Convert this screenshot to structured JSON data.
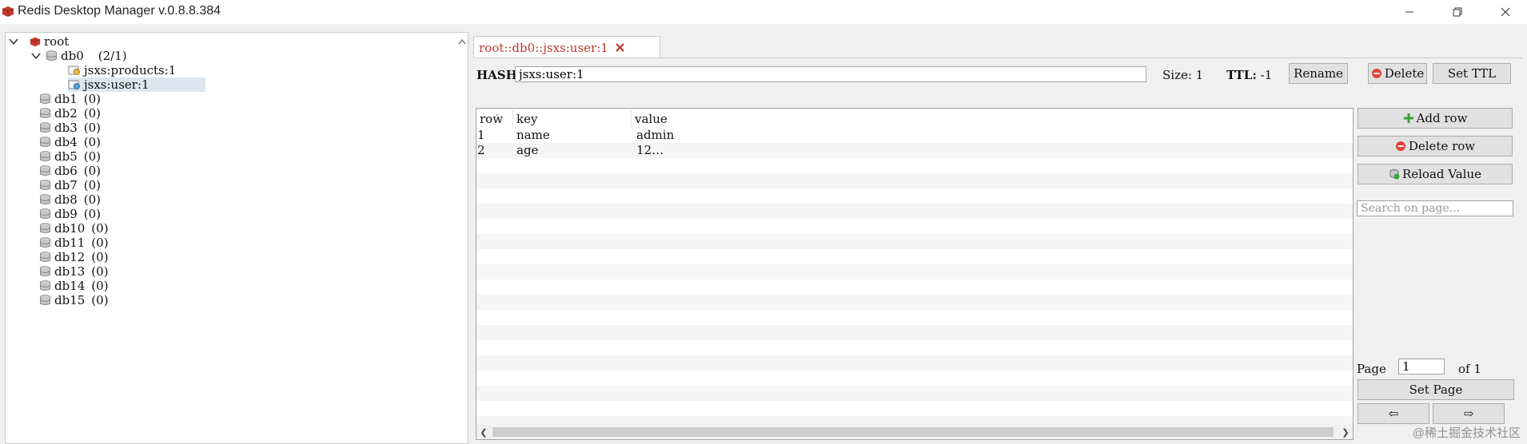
{
  "window": {
    "title": "Redis Desktop Manager v.0.8.8.384",
    "minimize_icon": "minimize-icon",
    "restore_icon": "restore-icon",
    "close_icon": "close-icon"
  },
  "tree": {
    "root_label": "root",
    "db0_label": "db0",
    "db0_count": "(2/1)",
    "keys": [
      "jsxs:products:1",
      "jsxs:user:1"
    ],
    "dbs": [
      {
        "name": "db1",
        "count": "(0)"
      },
      {
        "name": "db2",
        "count": "(0)"
      },
      {
        "name": "db3",
        "count": "(0)"
      },
      {
        "name": "db4",
        "count": "(0)"
      },
      {
        "name": "db5",
        "count": "(0)"
      },
      {
        "name": "db6",
        "count": "(0)"
      },
      {
        "name": "db7",
        "count": "(0)"
      },
      {
        "name": "db8",
        "count": "(0)"
      },
      {
        "name": "db9",
        "count": "(0)"
      },
      {
        "name": "db10",
        "count": "(0)"
      },
      {
        "name": "db11",
        "count": "(0)"
      },
      {
        "name": "db12",
        "count": "(0)"
      },
      {
        "name": "db13",
        "count": "(0)"
      },
      {
        "name": "db14",
        "count": "(0)"
      },
      {
        "name": "db15",
        "count": "(0)"
      }
    ]
  },
  "tab": {
    "label": "root::db0::jsxs:user:1"
  },
  "key_header": {
    "type_label": "HASH:",
    "key_value": "jsxs:user:1",
    "size_text": "Size: 1",
    "ttl_label": "TTL:",
    "ttl_value": "-1",
    "rename_label": "Rename",
    "delete_label": "Delete",
    "set_ttl_label": "Set TTL"
  },
  "table": {
    "columns": [
      "row",
      "key",
      "value"
    ],
    "rows": [
      {
        "row": "1",
        "key": "name",
        "value": "admin"
      },
      {
        "row": "2",
        "key": "age",
        "value": "12…"
      }
    ]
  },
  "side_actions": {
    "add_row_label": "Add row",
    "delete_row_label": "Delete row",
    "reload_label": "Reload Value",
    "search_placeholder": "Search on page...",
    "page_label": "Page",
    "page_value": "1",
    "of_label": "of 1",
    "set_page_label": "Set Page",
    "prev_label": "⇦",
    "next_label": "⇨"
  },
  "watermark": "@稀土掘金技术社区",
  "colors": {
    "accent_red": "#c0392b",
    "selected_bg": "#dde6f0"
  }
}
